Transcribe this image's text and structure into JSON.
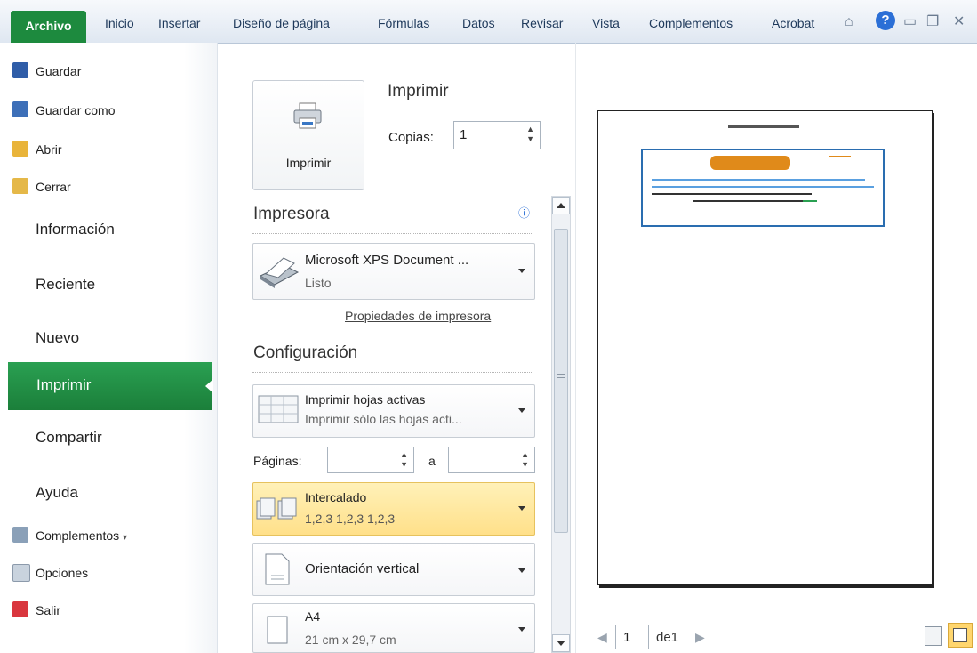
{
  "ribbon": {
    "file_tab": "Archivo",
    "tabs": [
      "Inicio",
      "Insertar",
      "Diseño de página",
      "Fórmulas",
      "Datos",
      "Revisar",
      "Vista",
      "Complementos",
      "Acrobat"
    ],
    "help_symbol": "?"
  },
  "nav": {
    "top_items": [
      {
        "label": "Guardar",
        "icon": "save-icon"
      },
      {
        "label": "Guardar como",
        "icon": "save-as-icon"
      },
      {
        "label": "Abrir",
        "icon": "folder-open-icon"
      },
      {
        "label": "Cerrar",
        "icon": "folder-close-icon"
      }
    ],
    "sections": [
      "Información",
      "Reciente",
      "Nuevo",
      "Imprimir",
      "Compartir",
      "Ayuda"
    ],
    "active": "Imprimir",
    "bottom_items": [
      {
        "label": "Complementos",
        "icon": "addins-icon"
      },
      {
        "label": "Opciones",
        "icon": "options-icon"
      },
      {
        "label": "Salir",
        "icon": "exit-icon"
      }
    ]
  },
  "print": {
    "button_label": "Imprimir",
    "heading": "Imprimir",
    "copies_label": "Copias:",
    "copies_value": "1",
    "printer_heading": "Impresora",
    "printer_name": "Microsoft XPS Document ...",
    "printer_status": "Listo",
    "printer_properties_link": "Propiedades de impresora",
    "settings_heading": "Configuración",
    "what_title": "Imprimir hojas activas",
    "what_sub": "Imprimir sólo las hojas acti...",
    "pages_label": "Páginas:",
    "pages_to_label": "a",
    "collate_title": "Intercalado",
    "collate_sub": "1,2,3   1,2,3   1,2,3",
    "orientation": "Orientación vertical",
    "paper_title": "A4",
    "paper_sub": "21 cm x 29,7 cm"
  },
  "preview": {
    "page_number": "1",
    "of_label": "de1"
  },
  "colors": {
    "accent_green": "#1d8a3e",
    "highlight_yellow": "#ffe08a",
    "help_blue": "#2b6fd6"
  }
}
